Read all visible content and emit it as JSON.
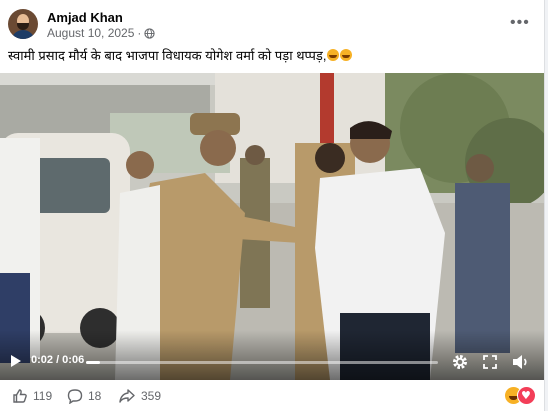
{
  "post": {
    "author": "Amjad Khan",
    "date": "August 10, 2025",
    "separator": "·",
    "caption": "स्वामी प्रसाद मौर्य के बाद भाजपा विधायक योगेश वर्मा को पड़ा थप्पड़,"
  },
  "video": {
    "time": "0:02 / 0:06",
    "progress": 0.04
  },
  "stats": {
    "likes": "119",
    "comments": "18",
    "shares": "359"
  },
  "icons": {
    "privacy": "globe-icon",
    "more": "more-options-icon",
    "play": "play-icon",
    "settings": "gear-icon",
    "fullscreen": "fullscreen-icon",
    "volume": "volume-icon",
    "like": "thumbs-up-icon",
    "comment": "comment-icon",
    "share": "share-icon",
    "reactions": [
      "haha-reaction-icon",
      "love-reaction-icon"
    ]
  },
  "colors": {
    "text": "#050505",
    "secondary": "#65676b",
    "police_uniform": "#b89a6a",
    "white_shirt": "#f2f2f2"
  }
}
